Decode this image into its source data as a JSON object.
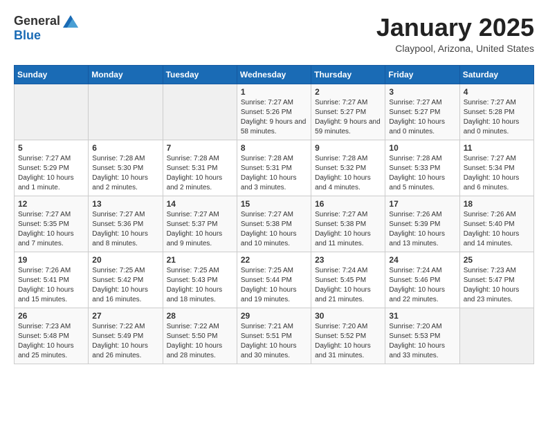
{
  "header": {
    "logo_general": "General",
    "logo_blue": "Blue",
    "title": "January 2025",
    "subtitle": "Claypool, Arizona, United States"
  },
  "weekdays": [
    "Sunday",
    "Monday",
    "Tuesday",
    "Wednesday",
    "Thursday",
    "Friday",
    "Saturday"
  ],
  "weeks": [
    [
      {
        "day": "",
        "empty": true
      },
      {
        "day": "",
        "empty": true
      },
      {
        "day": "",
        "empty": true
      },
      {
        "day": "1",
        "sunrise": "7:27 AM",
        "sunset": "5:26 PM",
        "daylight": "9 hours and 58 minutes."
      },
      {
        "day": "2",
        "sunrise": "7:27 AM",
        "sunset": "5:27 PM",
        "daylight": "9 hours and 59 minutes."
      },
      {
        "day": "3",
        "sunrise": "7:27 AM",
        "sunset": "5:27 PM",
        "daylight": "10 hours and 0 minutes."
      },
      {
        "day": "4",
        "sunrise": "7:27 AM",
        "sunset": "5:28 PM",
        "daylight": "10 hours and 0 minutes."
      }
    ],
    [
      {
        "day": "5",
        "sunrise": "7:27 AM",
        "sunset": "5:29 PM",
        "daylight": "10 hours and 1 minute."
      },
      {
        "day": "6",
        "sunrise": "7:28 AM",
        "sunset": "5:30 PM",
        "daylight": "10 hours and 2 minutes."
      },
      {
        "day": "7",
        "sunrise": "7:28 AM",
        "sunset": "5:31 PM",
        "daylight": "10 hours and 2 minutes."
      },
      {
        "day": "8",
        "sunrise": "7:28 AM",
        "sunset": "5:31 PM",
        "daylight": "10 hours and 3 minutes."
      },
      {
        "day": "9",
        "sunrise": "7:28 AM",
        "sunset": "5:32 PM",
        "daylight": "10 hours and 4 minutes."
      },
      {
        "day": "10",
        "sunrise": "7:28 AM",
        "sunset": "5:33 PM",
        "daylight": "10 hours and 5 minutes."
      },
      {
        "day": "11",
        "sunrise": "7:27 AM",
        "sunset": "5:34 PM",
        "daylight": "10 hours and 6 minutes."
      }
    ],
    [
      {
        "day": "12",
        "sunrise": "7:27 AM",
        "sunset": "5:35 PM",
        "daylight": "10 hours and 7 minutes."
      },
      {
        "day": "13",
        "sunrise": "7:27 AM",
        "sunset": "5:36 PM",
        "daylight": "10 hours and 8 minutes."
      },
      {
        "day": "14",
        "sunrise": "7:27 AM",
        "sunset": "5:37 PM",
        "daylight": "10 hours and 9 minutes."
      },
      {
        "day": "15",
        "sunrise": "7:27 AM",
        "sunset": "5:38 PM",
        "daylight": "10 hours and 10 minutes."
      },
      {
        "day": "16",
        "sunrise": "7:27 AM",
        "sunset": "5:38 PM",
        "daylight": "10 hours and 11 minutes."
      },
      {
        "day": "17",
        "sunrise": "7:26 AM",
        "sunset": "5:39 PM",
        "daylight": "10 hours and 13 minutes."
      },
      {
        "day": "18",
        "sunrise": "7:26 AM",
        "sunset": "5:40 PM",
        "daylight": "10 hours and 14 minutes."
      }
    ],
    [
      {
        "day": "19",
        "sunrise": "7:26 AM",
        "sunset": "5:41 PM",
        "daylight": "10 hours and 15 minutes."
      },
      {
        "day": "20",
        "sunrise": "7:25 AM",
        "sunset": "5:42 PM",
        "daylight": "10 hours and 16 minutes."
      },
      {
        "day": "21",
        "sunrise": "7:25 AM",
        "sunset": "5:43 PM",
        "daylight": "10 hours and 18 minutes."
      },
      {
        "day": "22",
        "sunrise": "7:25 AM",
        "sunset": "5:44 PM",
        "daylight": "10 hours and 19 minutes."
      },
      {
        "day": "23",
        "sunrise": "7:24 AM",
        "sunset": "5:45 PM",
        "daylight": "10 hours and 21 minutes."
      },
      {
        "day": "24",
        "sunrise": "7:24 AM",
        "sunset": "5:46 PM",
        "daylight": "10 hours and 22 minutes."
      },
      {
        "day": "25",
        "sunrise": "7:23 AM",
        "sunset": "5:47 PM",
        "daylight": "10 hours and 23 minutes."
      }
    ],
    [
      {
        "day": "26",
        "sunrise": "7:23 AM",
        "sunset": "5:48 PM",
        "daylight": "10 hours and 25 minutes."
      },
      {
        "day": "27",
        "sunrise": "7:22 AM",
        "sunset": "5:49 PM",
        "daylight": "10 hours and 26 minutes."
      },
      {
        "day": "28",
        "sunrise": "7:22 AM",
        "sunset": "5:50 PM",
        "daylight": "10 hours and 28 minutes."
      },
      {
        "day": "29",
        "sunrise": "7:21 AM",
        "sunset": "5:51 PM",
        "daylight": "10 hours and 30 minutes."
      },
      {
        "day": "30",
        "sunrise": "7:20 AM",
        "sunset": "5:52 PM",
        "daylight": "10 hours and 31 minutes."
      },
      {
        "day": "31",
        "sunrise": "7:20 AM",
        "sunset": "5:53 PM",
        "daylight": "10 hours and 33 minutes."
      },
      {
        "day": "",
        "empty": true
      }
    ]
  ],
  "labels": {
    "sunrise": "Sunrise:",
    "sunset": "Sunset:",
    "daylight": "Daylight:"
  }
}
